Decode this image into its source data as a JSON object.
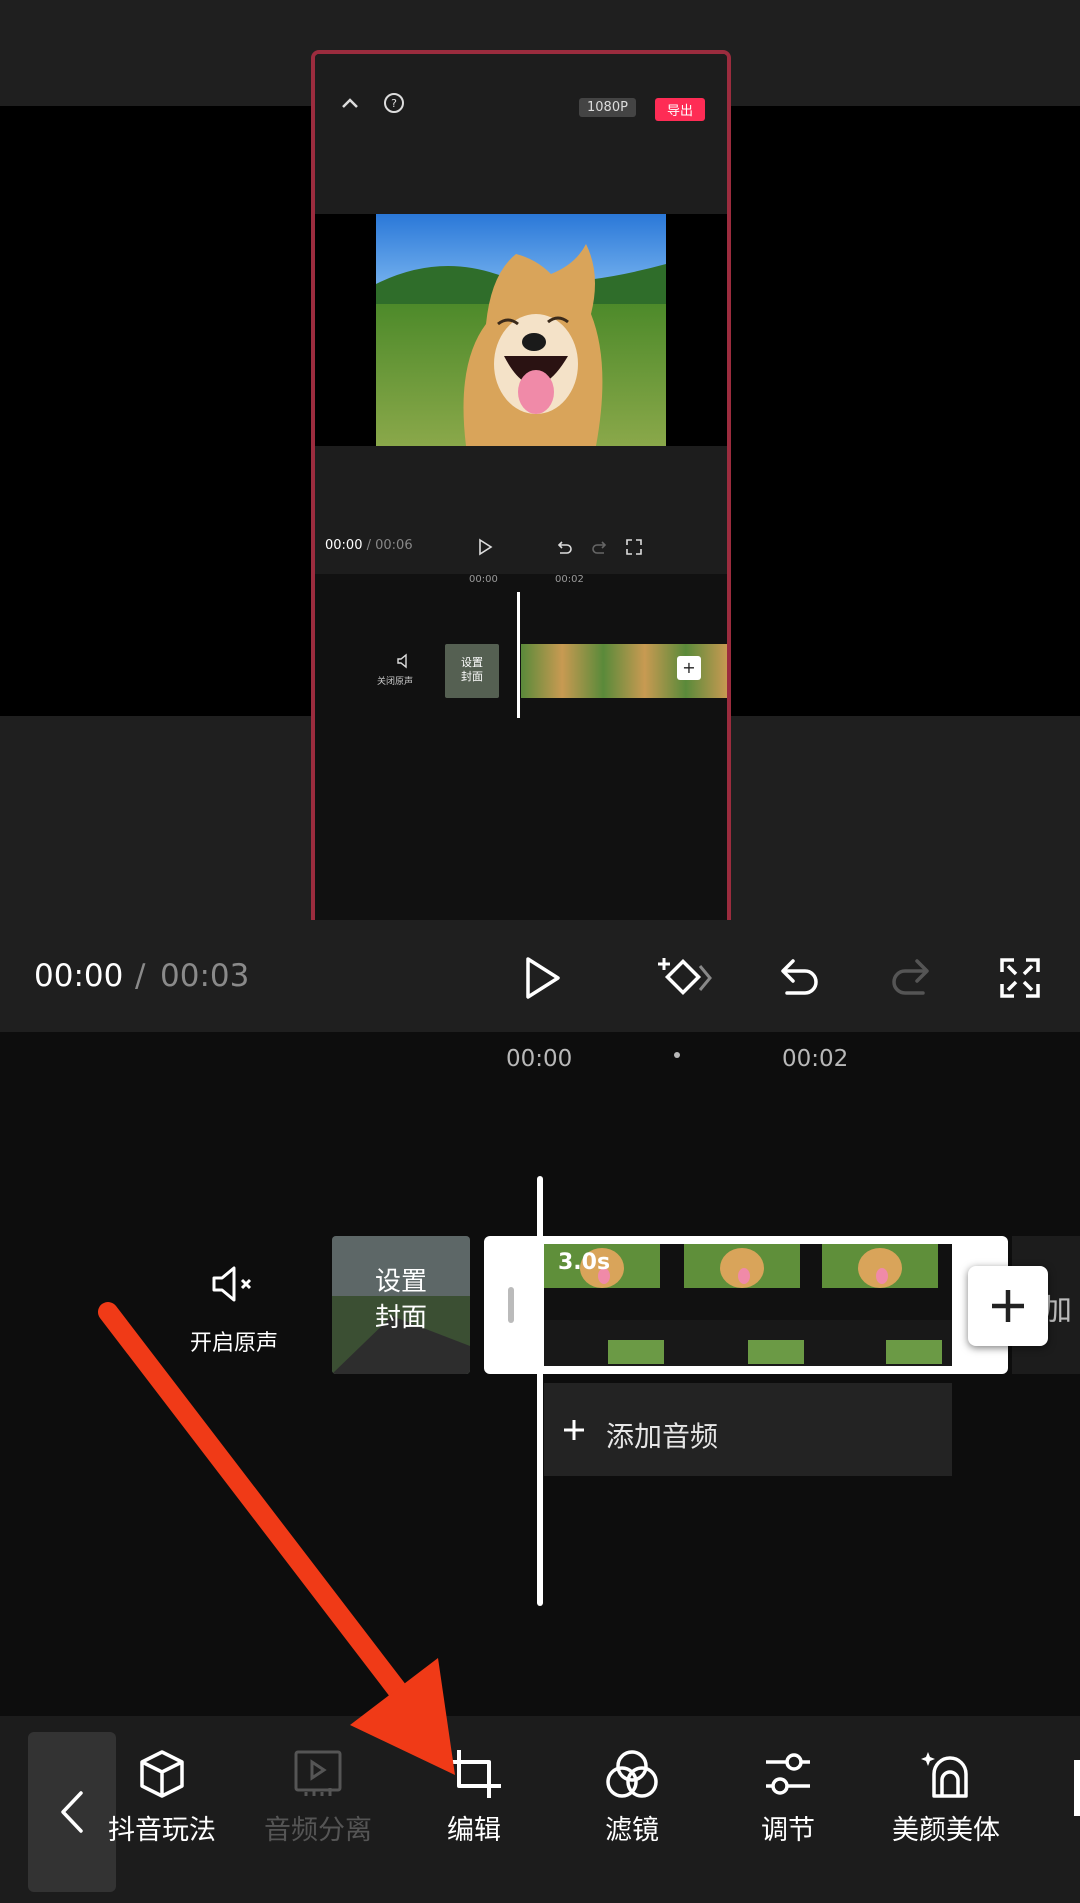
{
  "preview": {
    "inner_screen": {
      "resolution": "1080P",
      "export_label": "导出",
      "time_current": "00:00",
      "time_total": "00:06",
      "ruler": [
        "00:00",
        "00:02"
      ],
      "mute_label": "关闭原声",
      "cover_label_line1": "设置",
      "cover_label_line2": "封面"
    }
  },
  "player": {
    "time_current": "00:00",
    "time_separator": "/",
    "time_total": "00:03"
  },
  "timeline": {
    "ruler_ticks": [
      "00:00",
      "00:02"
    ],
    "mute_label": "开启原声",
    "cover_label_line1": "设置",
    "cover_label_line2": "封面",
    "clip_duration": "3.0s",
    "add_audio_label": "添加音频",
    "add_peek_text": "加"
  },
  "toolbar": {
    "items": [
      {
        "label": "抖音玩法",
        "icon": "cube-icon",
        "enabled": true
      },
      {
        "label": "音频分离",
        "icon": "audio-separate-icon",
        "enabled": false
      },
      {
        "label": "编辑",
        "icon": "crop-icon",
        "enabled": true
      },
      {
        "label": "滤镜",
        "icon": "filter-icon",
        "enabled": true
      },
      {
        "label": "调节",
        "icon": "adjust-icon",
        "enabled": true
      },
      {
        "label": "美颜美体",
        "icon": "beauty-icon",
        "enabled": true
      }
    ]
  },
  "annotation": {
    "color": "#f03a17",
    "points_to": "编辑"
  },
  "colors": {
    "accent": "#fe2c55",
    "frame": "#9b2c3e",
    "arrow": "#f03a17"
  }
}
